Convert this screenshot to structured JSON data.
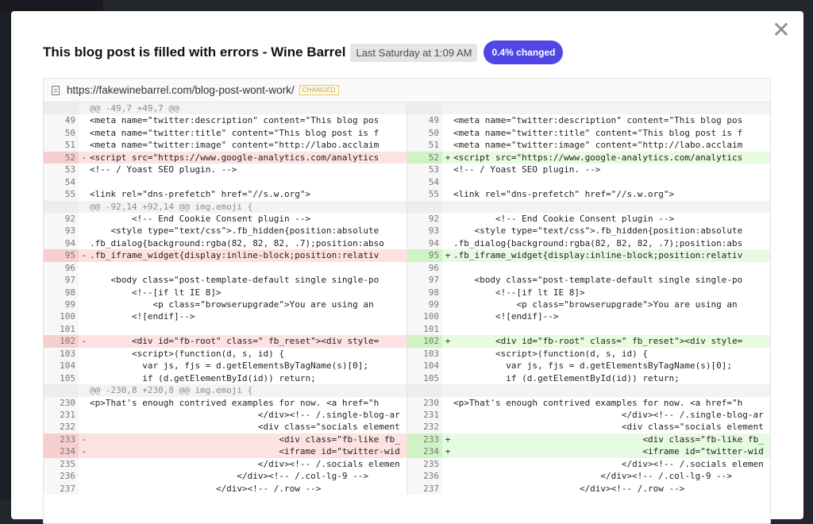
{
  "modal": {
    "title": "This blog post is filled with errors - Wine Barrel",
    "timestamp": "Last Saturday at 1:09 AM",
    "change_pct": "0.4% changed",
    "close_glyph": "✕"
  },
  "file": {
    "url": "https://fakewinebarrel.com/blog-post-wont-work/",
    "tag": "CHANGED"
  },
  "colors": {
    "accent": "#4f46e5",
    "removed_bg": "#fde2e2",
    "added_bg": "#e6fbe0",
    "tag": "#c89a2b"
  },
  "left_rows": [
    {
      "type": "hunk",
      "ln": "",
      "sign": "",
      "code": "@@ -49,7 +49,7 @@"
    },
    {
      "type": "ctx",
      "ln": "49",
      "sign": "",
      "code": "<meta name=\"twitter:description\" content=\"This blog pos"
    },
    {
      "type": "ctx",
      "ln": "50",
      "sign": "",
      "code": "<meta name=\"twitter:title\" content=\"This blog post is f"
    },
    {
      "type": "ctx",
      "ln": "51",
      "sign": "",
      "code": "<meta name=\"twitter:image\" content=\"http://labo.acclaim"
    },
    {
      "type": "del",
      "ln": "52",
      "sign": "-",
      "code": "<script src=\"https://www.google-analytics.com/analytics"
    },
    {
      "type": "ctx",
      "ln": "53",
      "sign": "",
      "code": "<!-- / Yoast SEO plugin. -->"
    },
    {
      "type": "ctx",
      "ln": "54",
      "sign": "",
      "code": ""
    },
    {
      "type": "ctx",
      "ln": "55",
      "sign": "",
      "code": "<link rel=\"dns-prefetch\" href=\"//s.w.org\">"
    },
    {
      "type": "hunk",
      "ln": "",
      "sign": "",
      "code": "@@ -92,14 +92,14 @@ img.emoji {"
    },
    {
      "type": "ctx",
      "ln": "92",
      "sign": "",
      "code": "        <!-- End Cookie Consent plugin -->"
    },
    {
      "type": "ctx",
      "ln": "93",
      "sign": "",
      "code": "    <style type=\"text/css\">.fb_hidden{position:absolute"
    },
    {
      "type": "ctx",
      "ln": "94",
      "sign": "",
      "code": ".fb_dialog{background:rgba(82, 82, 82, .7);position:abso"
    },
    {
      "type": "del",
      "ln": "95",
      "sign": "-",
      "code": ".fb_iframe_widget{display:inline-block;position:relativ"
    },
    {
      "type": "ctx",
      "ln": "96",
      "sign": "",
      "code": ""
    },
    {
      "type": "ctx",
      "ln": "97",
      "sign": "",
      "code": "    <body class=\"post-template-default single single-po"
    },
    {
      "type": "ctx",
      "ln": "98",
      "sign": "",
      "code": "        <!--[if lt IE 8]>"
    },
    {
      "type": "ctx",
      "ln": "99",
      "sign": "",
      "code": "            <p class=\"browserupgrade\">You are using an"
    },
    {
      "type": "ctx",
      "ln": "100",
      "sign": "",
      "code": "        <![endif]-->"
    },
    {
      "type": "ctx",
      "ln": "101",
      "sign": "",
      "code": ""
    },
    {
      "type": "del",
      "ln": "102",
      "sign": "-",
      "code": "        <div id=\"fb-root\" class=\" fb_reset\"><div style="
    },
    {
      "type": "ctx",
      "ln": "103",
      "sign": "",
      "code": "        <script>(function(d, s, id) {"
    },
    {
      "type": "ctx",
      "ln": "104",
      "sign": "",
      "code": "          var js, fjs = d.getElementsByTagName(s)[0];"
    },
    {
      "type": "ctx",
      "ln": "105",
      "sign": "",
      "code": "          if (d.getElementById(id)) return;"
    },
    {
      "type": "hunk",
      "ln": "",
      "sign": "",
      "code": "@@ -230,8 +230,8 @@ img.emoji {"
    },
    {
      "type": "ctx",
      "ln": "230",
      "sign": "",
      "code": "<p>That's enough contrived examples for now. <a href=\"h"
    },
    {
      "type": "ctx",
      "ln": "231",
      "sign": "",
      "code": "                                </div><!-- /.single-blog-ar"
    },
    {
      "type": "ctx",
      "ln": "232",
      "sign": "",
      "code": "                                <div class=\"socials element"
    },
    {
      "type": "del",
      "ln": "233",
      "sign": "-",
      "code": "                                    <div class=\"fb-like fb_"
    },
    {
      "type": "del",
      "ln": "234",
      "sign": "-",
      "code": "                                    <iframe id=\"twitter-wid"
    },
    {
      "type": "ctx",
      "ln": "235",
      "sign": "",
      "code": "                                </div><!-- /.socials elemen"
    },
    {
      "type": "ctx",
      "ln": "236",
      "sign": "",
      "code": "                            </div><!-- /.col-lg-9 -->"
    },
    {
      "type": "ctx",
      "ln": "237",
      "sign": "",
      "code": "                        </div><!-- /.row -->"
    }
  ],
  "right_rows": [
    {
      "type": "hunk",
      "ln": "",
      "sign": "",
      "code": ""
    },
    {
      "type": "ctx",
      "ln": "49",
      "sign": "",
      "code": "<meta name=\"twitter:description\" content=\"This blog pos"
    },
    {
      "type": "ctx",
      "ln": "50",
      "sign": "",
      "code": "<meta name=\"twitter:title\" content=\"This blog post is f"
    },
    {
      "type": "ctx",
      "ln": "51",
      "sign": "",
      "code": "<meta name=\"twitter:image\" content=\"http://labo.acclaim"
    },
    {
      "type": "add",
      "ln": "52",
      "sign": "+",
      "code": "<script src=\"https://www.google-analytics.com/analytics"
    },
    {
      "type": "ctx",
      "ln": "53",
      "sign": "",
      "code": "<!-- / Yoast SEO plugin. -->"
    },
    {
      "type": "ctx",
      "ln": "54",
      "sign": "",
      "code": ""
    },
    {
      "type": "ctx",
      "ln": "55",
      "sign": "",
      "code": "<link rel=\"dns-prefetch\" href=\"//s.w.org\">"
    },
    {
      "type": "hunk",
      "ln": "",
      "sign": "",
      "code": ""
    },
    {
      "type": "ctx",
      "ln": "92",
      "sign": "",
      "code": "        <!-- End Cookie Consent plugin -->"
    },
    {
      "type": "ctx",
      "ln": "93",
      "sign": "",
      "code": "    <style type=\"text/css\">.fb_hidden{position:absolute"
    },
    {
      "type": "ctx",
      "ln": "94",
      "sign": "",
      "code": ".fb_dialog{background:rgba(82, 82, 82, .7);position:abs"
    },
    {
      "type": "add",
      "ln": "95",
      "sign": "+",
      "code": ".fb_iframe_widget{display:inline-block;position:relativ"
    },
    {
      "type": "ctx",
      "ln": "96",
      "sign": "",
      "code": ""
    },
    {
      "type": "ctx",
      "ln": "97",
      "sign": "",
      "code": "    <body class=\"post-template-default single single-po"
    },
    {
      "type": "ctx",
      "ln": "98",
      "sign": "",
      "code": "        <!--[if lt IE 8]>"
    },
    {
      "type": "ctx",
      "ln": "99",
      "sign": "",
      "code": "            <p class=\"browserupgrade\">You are using an"
    },
    {
      "type": "ctx",
      "ln": "100",
      "sign": "",
      "code": "        <![endif]-->"
    },
    {
      "type": "ctx",
      "ln": "101",
      "sign": "",
      "code": ""
    },
    {
      "type": "add",
      "ln": "102",
      "sign": "+",
      "code": "        <div id=\"fb-root\" class=\" fb_reset\"><div style="
    },
    {
      "type": "ctx",
      "ln": "103",
      "sign": "",
      "code": "        <script>(function(d, s, id) {"
    },
    {
      "type": "ctx",
      "ln": "104",
      "sign": "",
      "code": "          var js, fjs = d.getElementsByTagName(s)[0];"
    },
    {
      "type": "ctx",
      "ln": "105",
      "sign": "",
      "code": "          if (d.getElementById(id)) return;"
    },
    {
      "type": "hunk",
      "ln": "",
      "sign": "",
      "code": ""
    },
    {
      "type": "ctx",
      "ln": "230",
      "sign": "",
      "code": "<p>That's enough contrived examples for now. <a href=\"h"
    },
    {
      "type": "ctx",
      "ln": "231",
      "sign": "",
      "code": "                                </div><!-- /.single-blog-ar"
    },
    {
      "type": "ctx",
      "ln": "232",
      "sign": "",
      "code": "                                <div class=\"socials element"
    },
    {
      "type": "add",
      "ln": "233",
      "sign": "+",
      "code": "                                    <div class=\"fb-like fb_"
    },
    {
      "type": "add",
      "ln": "234",
      "sign": "+",
      "code": "                                    <iframe id=\"twitter-wid"
    },
    {
      "type": "ctx",
      "ln": "235",
      "sign": "",
      "code": "                                </div><!-- /.socials elemen"
    },
    {
      "type": "ctx",
      "ln": "236",
      "sign": "",
      "code": "                            </div><!-- /.col-lg-9 -->"
    },
    {
      "type": "ctx",
      "ln": "237",
      "sign": "",
      "code": "                        </div><!-- /.row -->"
    }
  ]
}
